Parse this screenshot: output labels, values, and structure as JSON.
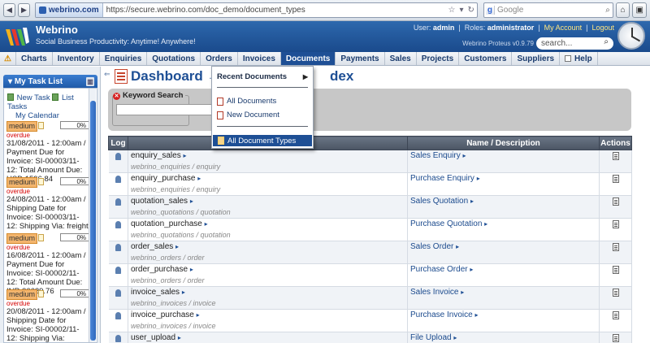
{
  "browser": {
    "site_badge": "webrino.com",
    "url": "https://secure.webrino.com/doc_demo/document_types",
    "search_placeholder": "Google",
    "search_engine": "g"
  },
  "app": {
    "brand": "Webrino",
    "tagline": "Social Business Productivity: Anytime! Anywhere!",
    "user_label": "User:",
    "user": "admin",
    "roles_label": "Roles:",
    "roles": "administrator",
    "my_account": "My Account",
    "logout": "Logout",
    "version": "Webrino Proteus v0.9.79",
    "search_placeholder": "search..."
  },
  "menu": {
    "items": [
      "Charts",
      "Inventory",
      "Enquiries",
      "Quotations",
      "Orders",
      "Invoices",
      "Documents",
      "Payments",
      "Sales",
      "Projects",
      "Customers",
      "Suppliers"
    ],
    "help": "Help",
    "active": "Documents"
  },
  "dropdown": {
    "recent": "Recent Documents",
    "all_documents": "All Documents",
    "new_document": "New Document",
    "all_document_types": "All Document Types"
  },
  "sidebar": {
    "title": "My Task List",
    "new_task": "New Task",
    "list_tasks": "List Tasks",
    "my_calendar": "My Calendar",
    "tasks": [
      {
        "priority": "medium",
        "pct": "0%",
        "status": "overdue",
        "desc": "31/08/2011 - 12:00am / Payment Due for Invoice: SI-00003/11-12: Total Amount Due: USD 1596.84"
      },
      {
        "priority": "medium",
        "pct": "0%",
        "status": "overdue",
        "desc": "24/08/2011 - 12:00am / Shipping Date for Invoice: SI-00003/11-12: Shipping Via: freight"
      },
      {
        "priority": "medium",
        "pct": "0%",
        "status": "overdue",
        "desc": "16/08/2011 - 12:00am / Payment Due for Invoice: SI-00002/11-12: Total Amount Due: INR 36629.76"
      },
      {
        "priority": "medium",
        "pct": "0%",
        "status": "overdue",
        "desc": "20/08/2011 - 12:00am / Shipping Date for Invoice: SI-00002/11-12: Shipping Via:"
      }
    ]
  },
  "main": {
    "title_head": "Dashboard → Doc",
    "title_tail": "dex",
    "keyword_search": "Keyword Search",
    "columns": {
      "log": "Log",
      "name": "",
      "desc": "Name / Description",
      "actions": "Actions"
    },
    "rows": [
      {
        "name": "enquiry_sales",
        "path": "webrino_enquiries / enquiry",
        "desc": "Sales Enquiry"
      },
      {
        "name": "enquiry_purchase",
        "path": "webrino_enquiries / enquiry",
        "desc": "Purchase Enquiry"
      },
      {
        "name": "quotation_sales",
        "path": "webrino_quotations / quotation",
        "desc": "Sales Quotation"
      },
      {
        "name": "quotation_purchase",
        "path": "webrino_quotations / quotation",
        "desc": "Purchase Quotation"
      },
      {
        "name": "order_sales",
        "path": "webrino_orders / order",
        "desc": "Sales Order"
      },
      {
        "name": "order_purchase",
        "path": "webrino_orders / order",
        "desc": "Purchase Order"
      },
      {
        "name": "invoice_sales",
        "path": "webrino_invoices / invoice",
        "desc": "Sales Invoice"
      },
      {
        "name": "invoice_purchase",
        "path": "webrino_invoices / invoice",
        "desc": "Purchase Invoice"
      },
      {
        "name": "user_upload",
        "path": "",
        "desc": "File Upload"
      }
    ]
  },
  "colors": {
    "brand_blue": "#1e4f95",
    "overdue_red": "#d40000",
    "priority_orange": "#f3b56d"
  }
}
